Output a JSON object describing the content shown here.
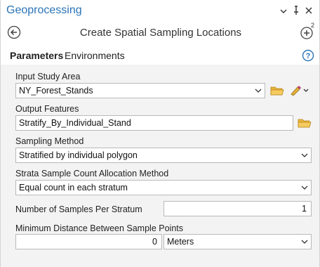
{
  "window": {
    "title": "Geoprocessing",
    "controls": [
      "chevron-down-icon",
      "pin-icon",
      "close-icon"
    ]
  },
  "header": {
    "tool_title": "Create Spatial Sampling Locations",
    "add_badge": "2"
  },
  "tabs": [
    {
      "label": "Parameters",
      "active": true
    },
    {
      "label": "Environments",
      "active": false
    }
  ],
  "params": {
    "input_study_area": {
      "label": "Input Study Area",
      "value": "NY_Forest_Stands"
    },
    "output_features": {
      "label": "Output Features",
      "value": "Stratify_By_Individual_Stand"
    },
    "sampling_method": {
      "label": "Sampling Method",
      "value": "Stratified by individual polygon"
    },
    "allocation_method": {
      "label": "Strata Sample Count Allocation Method",
      "value": "Equal count in each stratum"
    },
    "samples_per_stratum": {
      "label": "Number of Samples Per Stratum",
      "value": "1"
    },
    "min_distance": {
      "label": "Minimum Distance Between Sample Points",
      "value": "0",
      "unit": "Meters"
    }
  },
  "colors": {
    "accent": "#2a74b8",
    "folder": "#e8b23a",
    "form_bg": "#f3f3f3"
  }
}
